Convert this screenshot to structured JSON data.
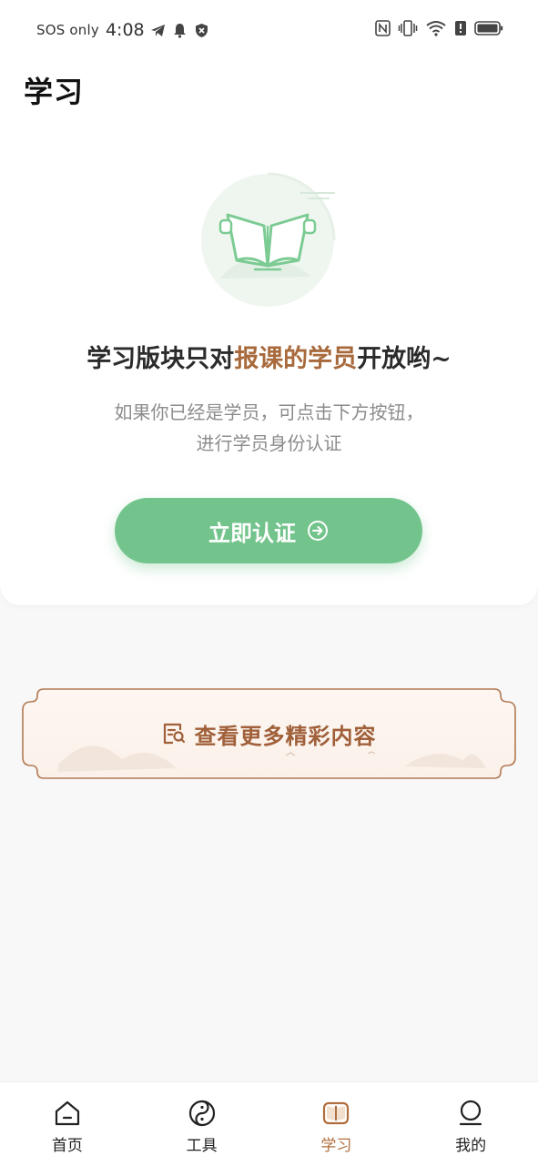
{
  "status_bar": {
    "carrier": "SOS only",
    "time": "4:08",
    "left_icons": [
      "telegram-icon",
      "bell-icon",
      "shield-x-icon"
    ],
    "right_icons": [
      "nfc-icon",
      "vibrate-icon",
      "wifi-icon",
      "alert-icon",
      "battery-icon"
    ]
  },
  "page": {
    "title": "学习"
  },
  "notice": {
    "headline_pre": "学习版块只对",
    "headline_highlight": "报课的学员",
    "headline_post": "开放哟~",
    "desc_line1": "如果你已经是学员，可点击下方按钮，",
    "desc_line2": "进行学员身份认证",
    "button_label": "立即认证",
    "illustration_icon": "open-book-icon"
  },
  "more_banner": {
    "label": "查看更多精彩内容",
    "icon": "doc-search-icon"
  },
  "bottom_nav": {
    "items": [
      {
        "label": "首页",
        "icon": "home-icon",
        "active": false
      },
      {
        "label": "工具",
        "icon": "yinyang-icon",
        "active": false
      },
      {
        "label": "学习",
        "icon": "book-icon",
        "active": true
      },
      {
        "label": "我的",
        "icon": "user-icon",
        "active": false
      }
    ]
  },
  "colors": {
    "accent_green": "#73c48c",
    "accent_brown": "#a86a3c",
    "active_nav": "#b06e3c"
  }
}
